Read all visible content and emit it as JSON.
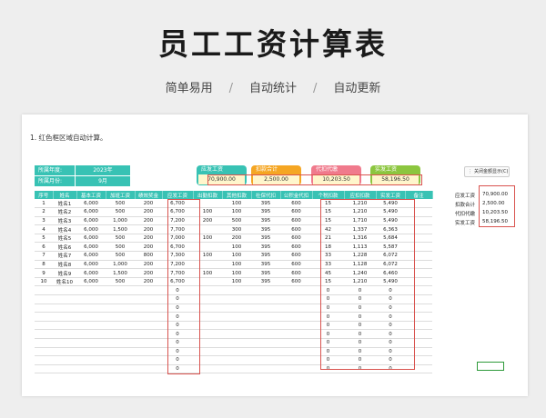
{
  "title": "员工工资计算表",
  "subtitle": [
    "简单易用",
    "自动统计",
    "自动更新"
  ],
  "subtitle_sep": "/",
  "note": "1. 红色框区域自动计算。",
  "info": [
    {
      "label": "所属年度:",
      "value": "2023年"
    },
    {
      "label": "所属月份:",
      "value": "9月"
    }
  ],
  "cards": [
    {
      "label": "应发工资",
      "value": "70,900.00",
      "color": "#38c2b4"
    },
    {
      "label": "扣款合计",
      "value": "2,500.00",
      "color": "#f5a623"
    },
    {
      "label": "代扣代缴",
      "value": "10,203.50",
      "color": "#f07a8c"
    },
    {
      "label": "实发工资",
      "value": "58,196.50",
      "color": "#8cc63f"
    }
  ],
  "toggle": {
    "icon": "⋮",
    "label": "关闭金额显示(C)"
  },
  "table": {
    "headers": [
      "序号",
      "姓名",
      "基本工资",
      "加班工资",
      "绩效奖金",
      "应发工资",
      "出勤扣款",
      "其他扣款",
      "社保代扣",
      "公积金代扣",
      "个税扣款",
      "应扣扣款",
      "实发工资",
      "备注"
    ],
    "rows": [
      [
        "1",
        "姓名1",
        "6,000",
        "500",
        "200",
        "6,700",
        "",
        "100",
        "395",
        "600",
        "15",
        "1,210",
        "5,490",
        ""
      ],
      [
        "2",
        "姓名2",
        "6,000",
        "500",
        "200",
        "6,700",
        "100",
        "100",
        "395",
        "600",
        "15",
        "1,210",
        "5,490",
        ""
      ],
      [
        "3",
        "姓名3",
        "6,000",
        "1,000",
        "200",
        "7,200",
        "200",
        "500",
        "395",
        "600",
        "15",
        "1,710",
        "5,490",
        ""
      ],
      [
        "4",
        "姓名4",
        "6,000",
        "1,500",
        "200",
        "7,700",
        "",
        "300",
        "395",
        "600",
        "42",
        "1,337",
        "6,363",
        ""
      ],
      [
        "5",
        "姓名5",
        "6,000",
        "500",
        "200",
        "7,000",
        "100",
        "200",
        "395",
        "600",
        "21",
        "1,316",
        "5,684",
        ""
      ],
      [
        "6",
        "姓名6",
        "6,000",
        "500",
        "200",
        "6,700",
        "",
        "100",
        "395",
        "600",
        "18",
        "1,113",
        "5,587",
        ""
      ],
      [
        "7",
        "姓名7",
        "6,000",
        "500",
        "800",
        "7,300",
        "100",
        "100",
        "395",
        "600",
        "33",
        "1,228",
        "6,072",
        ""
      ],
      [
        "8",
        "姓名8",
        "6,000",
        "1,000",
        "200",
        "7,200",
        "",
        "100",
        "395",
        "600",
        "33",
        "1,128",
        "6,072",
        ""
      ],
      [
        "9",
        "姓名9",
        "6,000",
        "1,500",
        "200",
        "7,700",
        "100",
        "100",
        "395",
        "600",
        "45",
        "1,240",
        "6,460",
        ""
      ],
      [
        "10",
        "姓名10",
        "6,000",
        "500",
        "200",
        "6,700",
        "",
        "100",
        "395",
        "600",
        "15",
        "1,210",
        "5,490",
        ""
      ],
      [
        "",
        "",
        "",
        "",
        "",
        "0",
        "",
        "",
        "",
        "",
        "0",
        "0",
        "0",
        ""
      ],
      [
        "",
        "",
        "",
        "",
        "",
        "0",
        "",
        "",
        "",
        "",
        "0",
        "0",
        "0",
        ""
      ],
      [
        "",
        "",
        "",
        "",
        "",
        "0",
        "",
        "",
        "",
        "",
        "0",
        "0",
        "0",
        ""
      ],
      [
        "",
        "",
        "",
        "",
        "",
        "0",
        "",
        "",
        "",
        "",
        "0",
        "0",
        "0",
        ""
      ],
      [
        "",
        "",
        "",
        "",
        "",
        "0",
        "",
        "",
        "",
        "",
        "0",
        "0",
        "0",
        ""
      ],
      [
        "",
        "",
        "",
        "",
        "",
        "0",
        "",
        "",
        "",
        "",
        "0",
        "0",
        "0",
        ""
      ],
      [
        "",
        "",
        "",
        "",
        "",
        "0",
        "",
        "",
        "",
        "",
        "0",
        "0",
        "0",
        ""
      ],
      [
        "",
        "",
        "",
        "",
        "",
        "0",
        "",
        "",
        "",
        "",
        "0",
        "0",
        "0",
        ""
      ],
      [
        "",
        "",
        "",
        "",
        "",
        "0",
        "",
        "",
        "",
        "",
        "0",
        "0",
        "0",
        ""
      ],
      [
        "",
        "",
        "",
        "",
        "",
        "0",
        "",
        "",
        "",
        "",
        "0",
        "0",
        "0",
        ""
      ]
    ]
  },
  "summary": [
    {
      "label": "应发工资",
      "value": "70,900.00"
    },
    {
      "label": "扣款合计",
      "value": "2,500.00"
    },
    {
      "label": "代扣代缴",
      "value": "10,203.50"
    },
    {
      "label": "实发工资",
      "value": "58,196.50"
    }
  ]
}
